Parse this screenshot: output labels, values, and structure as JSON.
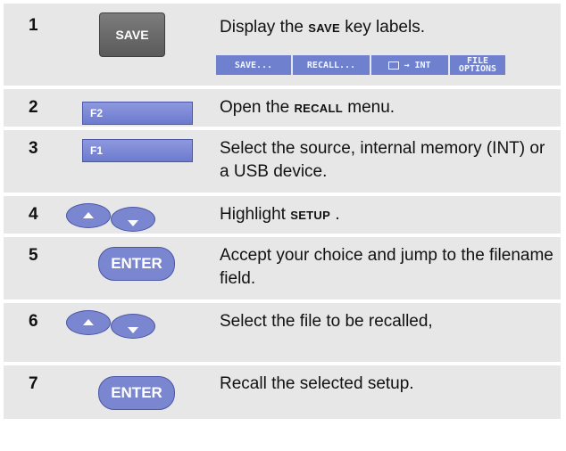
{
  "steps": [
    {
      "number": "1",
      "key_label": "SAVE",
      "text_pre": "Display the ",
      "text_bold": "SAVE",
      "text_post": " key labels."
    },
    {
      "number": "2",
      "key_label": "F2",
      "text_pre": "Open the ",
      "text_bold": "RECALL",
      "text_post": " menu."
    },
    {
      "number": "3",
      "key_label": "F1",
      "text": "Select the source, internal memory (INT) or a USB device."
    },
    {
      "number": "4",
      "key_label": "",
      "text_pre": "Highlight ",
      "text_bold": "SETUP",
      "text_post": " ."
    },
    {
      "number": "5",
      "key_label": "ENTER",
      "text": "Accept your choice and jump to the filename field."
    },
    {
      "number": "6",
      "key_label": "",
      "text": "Select the file to be recalled,"
    },
    {
      "number": "7",
      "key_label": "ENTER",
      "text": "Recall the selected setup."
    }
  ],
  "softkeys": {
    "save": "SAVE...",
    "recall": "RECALL...",
    "int": "→ INT",
    "file_line1": "FILE",
    "file_line2": "OPTIONS"
  },
  "colors": {
    "row_bg": "#e7e7e7",
    "key_blue": "#7b86d0",
    "save_key_gray": "#6a6a6a"
  }
}
